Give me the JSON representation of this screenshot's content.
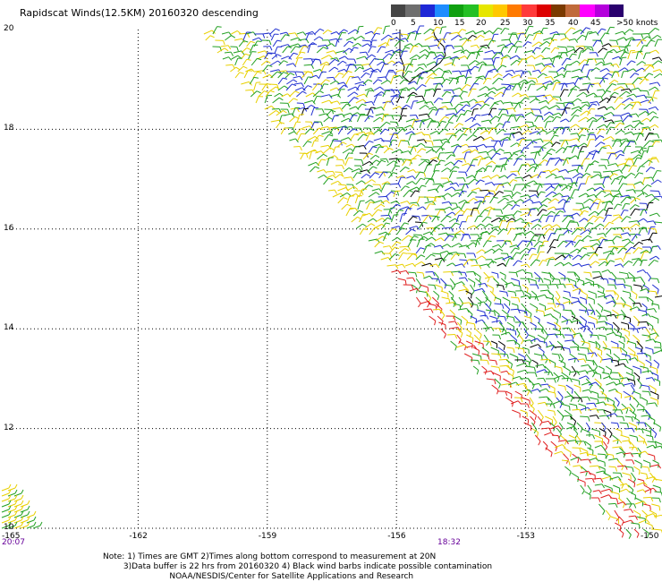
{
  "title": "Rapidscat Winds(12.5KM) 20160320 descending",
  "legend": {
    "colors": [
      "#454545",
      "#6e6e6e",
      "#1e28d6",
      "#1e8cff",
      "#10a010",
      "#25c025",
      "#e6e600",
      "#ffc800",
      "#ff7a00",
      "#ff3a3a",
      "#dd0000",
      "#7a3a00",
      "#c06a3a",
      "#ff00ff",
      "#b400dc",
      "#2a006e"
    ],
    "labels": [
      "0",
      "5",
      "10",
      "15",
      "20",
      "25",
      "30",
      "35",
      "40",
      "45",
      ">50 knots"
    ]
  },
  "axes": {
    "y_labels": [
      "20",
      "18",
      "16",
      "14",
      "12",
      "10"
    ],
    "x_labels": [
      "-165",
      "-162",
      "-159",
      "-156",
      "-153",
      "-150"
    ],
    "time_labels": [
      "20:07",
      "18:32"
    ]
  },
  "notes": {
    "line1": "Note: 1) Times are GMT 2)Times along bottom correspond to measurement at 20N",
    "line2": "3)Data buffer is 22 hrs from 20160320 4) Black wind barbs indicate possible contamination",
    "line3": "NOAA/NESDIS/Center for Satellite Applications and Research"
  },
  "map": {
    "lon_range": [
      -165,
      -150
    ],
    "lat_range": [
      10,
      20
    ],
    "barb_colors": {
      "green": "#22a022",
      "yellow": "#e8d000",
      "blue": "#2030d0",
      "red": "#e02020",
      "black": "#000000"
    }
  }
}
